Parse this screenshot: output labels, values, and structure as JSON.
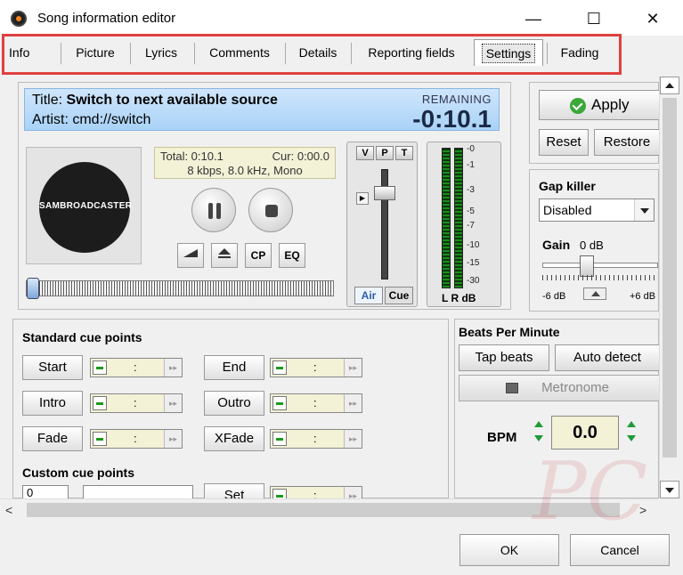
{
  "window": {
    "title": "Song information editor",
    "minimize_glyph": "—",
    "maximize_glyph": "☐",
    "close_glyph": "✕"
  },
  "tabs": [
    {
      "label": "Info"
    },
    {
      "label": "Picture"
    },
    {
      "label": "Lyrics"
    },
    {
      "label": "Comments"
    },
    {
      "label": "Details"
    },
    {
      "label": "Reporting fields"
    },
    {
      "label": "Settings",
      "active": true
    },
    {
      "label": "Fading"
    }
  ],
  "player": {
    "title_label": "Title:",
    "title_value": "Switch to next available source",
    "artist_label": "Artist:",
    "artist_value": "cmd://switch",
    "remaining_label": "REMAINING",
    "remaining_time": "-0:10.1",
    "logo_text": "SAMBROADCASTER",
    "total": "Total: 0:10.1",
    "cur": "Cur: 0:00.0",
    "format": "8 kbps, 8.0 kHz, Mono",
    "cp_label": "CP",
    "eq_label": "EQ",
    "seek_position": 0.0
  },
  "volume": {
    "v_label": "V",
    "p_label": "P",
    "t_label": "T",
    "air_label": "Air",
    "cue_label": "Cue",
    "level": 0.82
  },
  "meter": {
    "scale": [
      "-0",
      "-1",
      "-3",
      "-5",
      "-7",
      "-10",
      "-15",
      "-30"
    ],
    "label": "L R dB"
  },
  "actions": {
    "apply": "Apply",
    "reset": "Reset",
    "restore": "Restore"
  },
  "gap_killer": {
    "title": "Gap killer",
    "selected": "Disabled",
    "gain_label": "Gain",
    "gain_value": "0 dB",
    "min_label": "-6 dB",
    "max_label": "+6 dB"
  },
  "cue_points": {
    "standard_title": "Standard cue points",
    "items": [
      {
        "label": "Start",
        "time": ":"
      },
      {
        "label": "End",
        "time": ":"
      },
      {
        "label": "Intro",
        "time": ":"
      },
      {
        "label": "Outro",
        "time": ":"
      },
      {
        "label": "Fade",
        "time": ":"
      },
      {
        "label": "XFade",
        "time": ":"
      }
    ],
    "custom_title": "Custom cue points",
    "custom_index": "0",
    "set_label": "Set",
    "set_time": ":"
  },
  "bpm": {
    "title": "Beats Per Minute",
    "tap_label": "Tap beats",
    "auto_label": "Auto detect",
    "metronome_label": "Metronome",
    "bpm_label": "BPM",
    "bpm_value": "0.0"
  },
  "scroll": {
    "left_glyph": "<",
    "right_glyph": ">"
  },
  "footer": {
    "ok": "OK",
    "cancel": "Cancel"
  },
  "colors": {
    "highlight_box": "#e04040",
    "title_box": "#a9d2f7",
    "info_box": "#f3f1d6",
    "apply_check": "#3aa83a",
    "bpm_spin": "#1f9a3a"
  }
}
